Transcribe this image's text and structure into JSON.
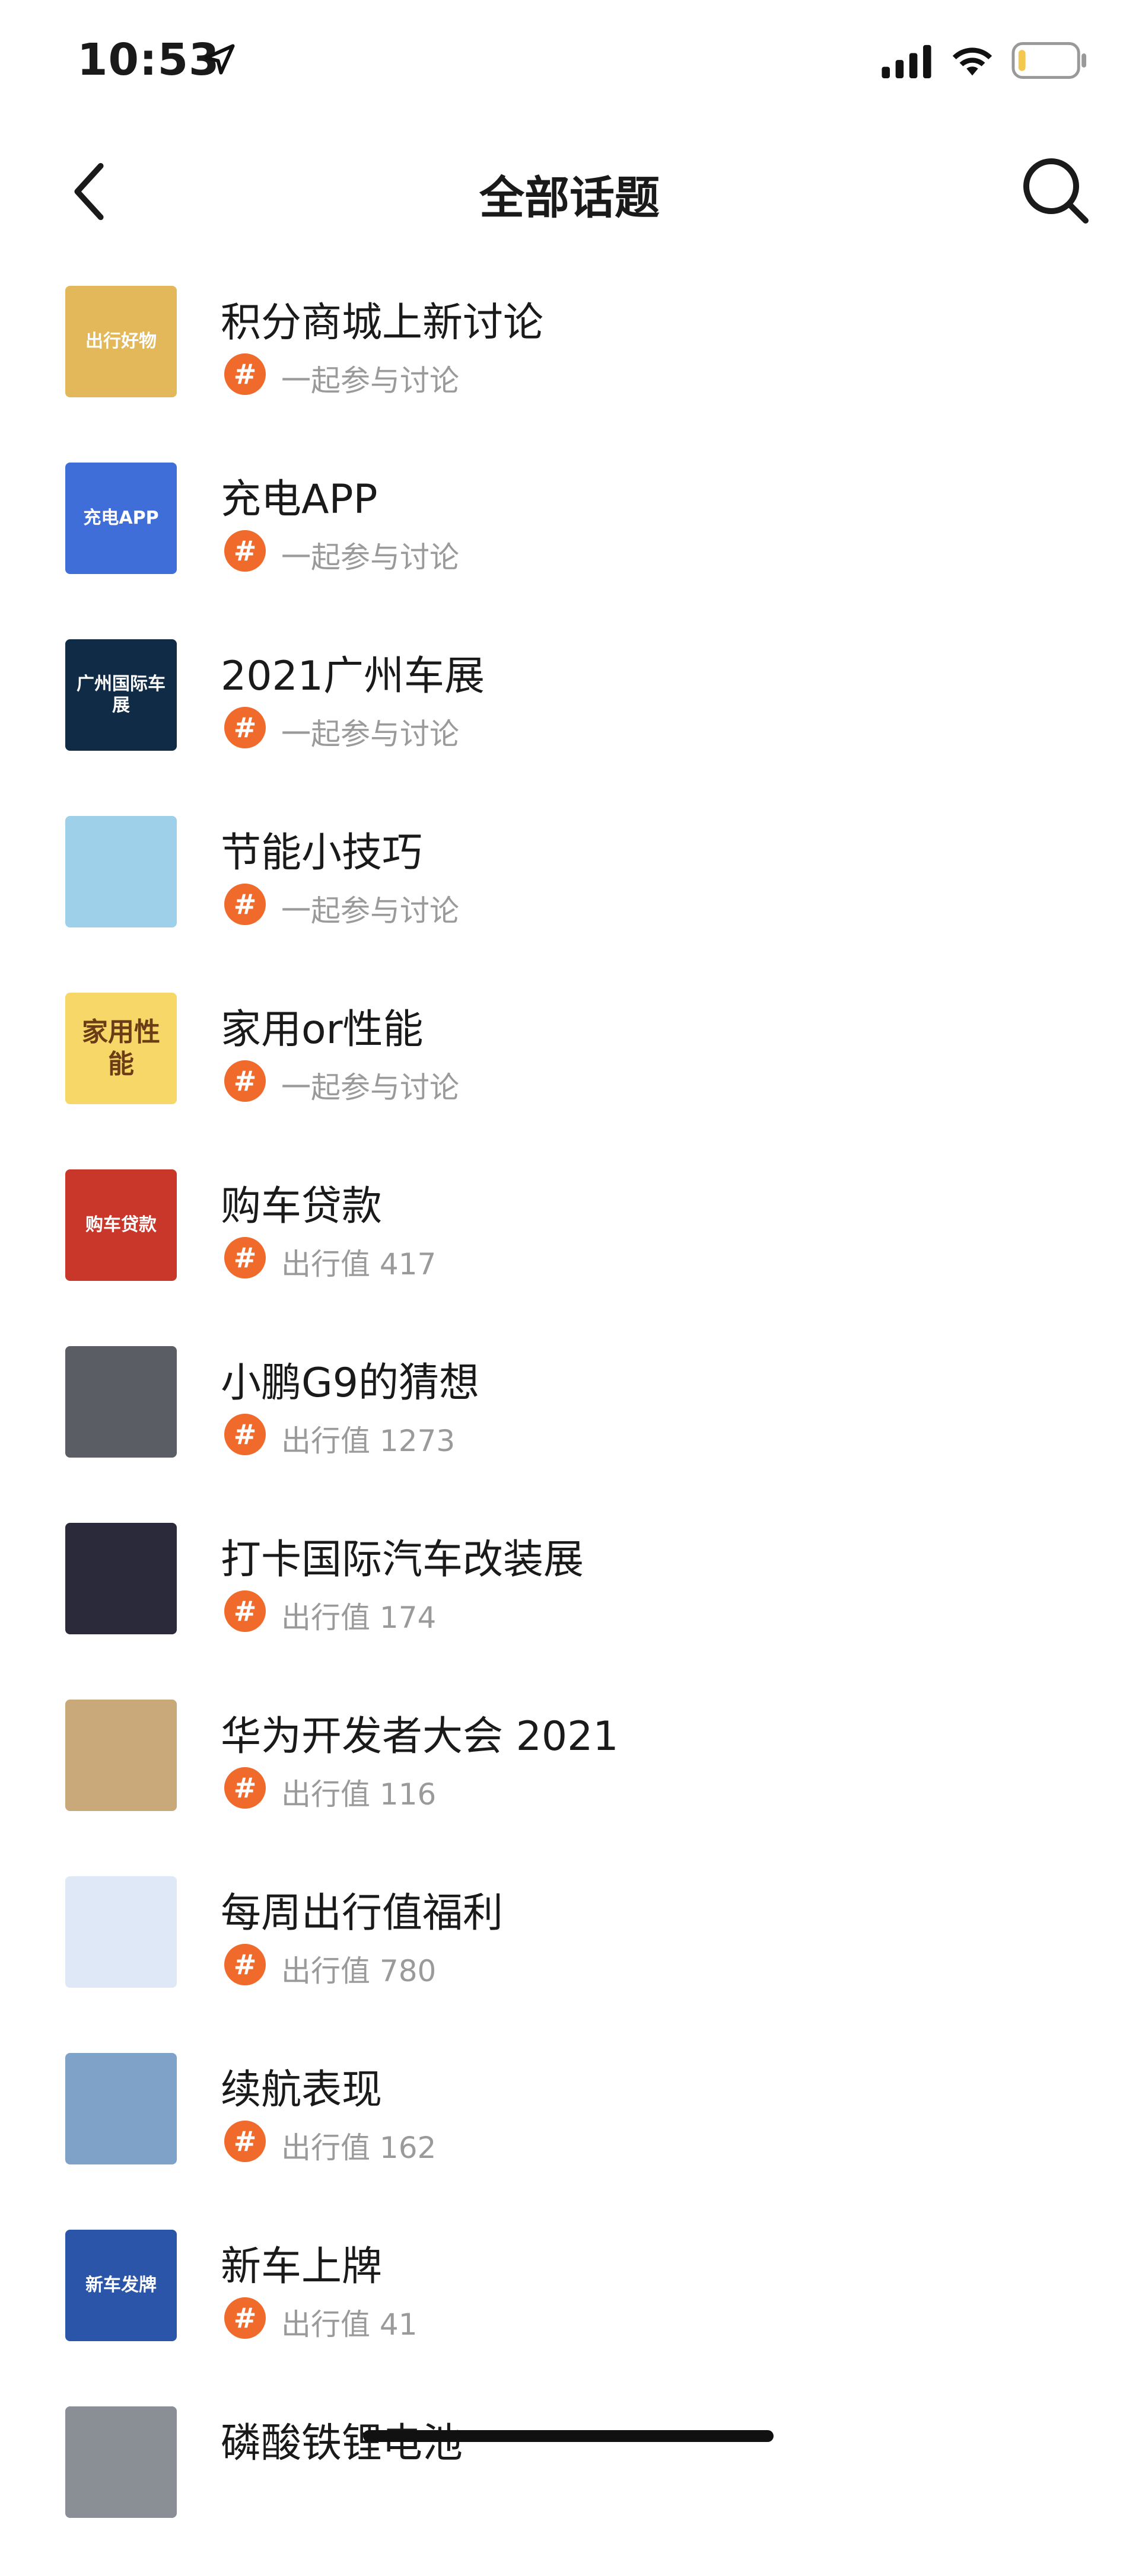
{
  "status_bar": {
    "time": "10:53"
  },
  "nav": {
    "title": "全部话题"
  },
  "topics": [
    {
      "title": "积分商城上新讨论",
      "subtitle": "一起参与讨论",
      "thumb_text": "出行好物",
      "thumb_color": "#e2b85a"
    },
    {
      "title": "充电APP",
      "subtitle": "一起参与讨论",
      "thumb_text": "充电APP",
      "thumb_color": "#3f6ed8"
    },
    {
      "title": "2021广州车展",
      "subtitle": "一起参与讨论",
      "thumb_text": "广州国际车展",
      "thumb_color": "#0f2b45"
    },
    {
      "title": "节能小技巧",
      "subtitle": "一起参与讨论",
      "thumb_text": "",
      "thumb_color": "#9fd0ea"
    },
    {
      "title": "家用or性能",
      "subtitle": "一起参与讨论",
      "thumb_text": "家用性能",
      "thumb_color": "#f6d767"
    },
    {
      "title": "购车贷款",
      "subtitle": "出行值 417",
      "thumb_text": "购车贷款",
      "thumb_color": "#c8372a"
    },
    {
      "title": "小鹏G9的猜想",
      "subtitle": "出行值 1273",
      "thumb_text": "",
      "thumb_color": "#5a5d63"
    },
    {
      "title": "打卡国际汽车改装展",
      "subtitle": "出行值 174",
      "thumb_text": "",
      "thumb_color": "#2a2a3a"
    },
    {
      "title": "华为开发者大会 2021",
      "subtitle": "出行值 116",
      "thumb_text": "",
      "thumb_color": "#c9a87a"
    },
    {
      "title": "每周出行值福利",
      "subtitle": "出行值 780",
      "thumb_text": "",
      "thumb_color": "#dfe8f6"
    },
    {
      "title": "续航表现",
      "subtitle": "出行值 162",
      "thumb_text": "",
      "thumb_color": "#7fa2c8"
    },
    {
      "title": "新车上牌",
      "subtitle": "出行值 41",
      "thumb_text": "新车发牌",
      "thumb_color": "#2b55a8"
    },
    {
      "title": "磷酸铁锂电池",
      "subtitle": "",
      "thumb_text": "",
      "thumb_color": "#8a8f96"
    }
  ]
}
